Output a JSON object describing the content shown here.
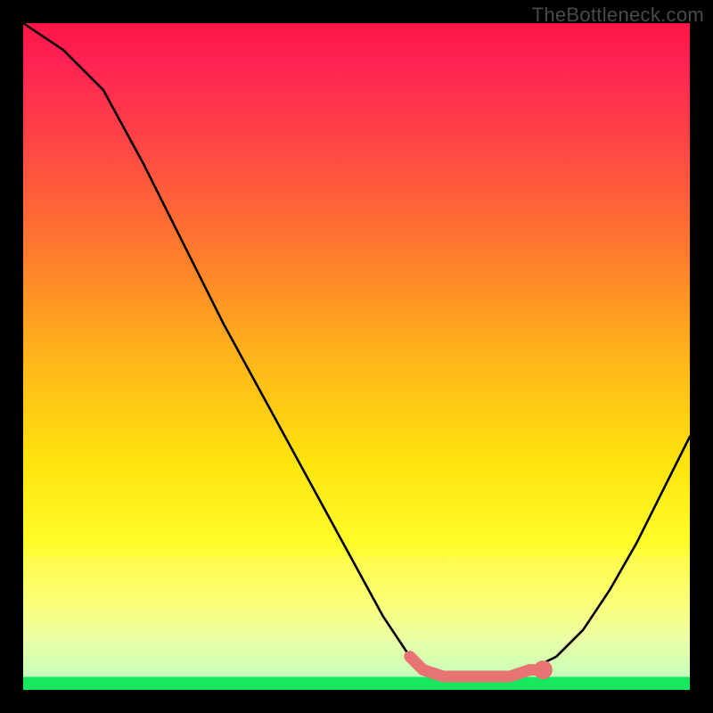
{
  "watermark": "TheBottleneck.com",
  "chart_data": {
    "type": "line",
    "title": "",
    "xlabel": "",
    "ylabel": "",
    "xlim": [
      0,
      100
    ],
    "ylim": [
      0,
      100
    ],
    "grid": false,
    "legend": false,
    "series": [
      {
        "name": "curve",
        "color": "#000000",
        "x": [
          0,
          6,
          12,
          18,
          24,
          30,
          36,
          42,
          48,
          54,
          58,
          60,
          63,
          66,
          70,
          73,
          76,
          80,
          84,
          88,
          92,
          96,
          100
        ],
        "y": [
          100,
          96,
          90,
          79,
          67,
          55,
          44,
          33,
          22,
          11,
          5,
          3,
          2,
          2,
          2,
          2,
          3,
          5,
          9,
          15,
          22,
          30,
          38
        ]
      }
    ],
    "highlight": {
      "name": "flat-zone",
      "color": "#e77373",
      "x": [
        58,
        60,
        63,
        66,
        70,
        73,
        76,
        78
      ],
      "y": [
        5,
        3,
        2,
        2,
        2,
        2,
        3,
        3
      ]
    },
    "highlight_dot": {
      "x": 78,
      "y": 3,
      "r": 1.4,
      "color": "#e77373"
    },
    "background_gradient": {
      "top": "#ff1646",
      "middle": "#ffe40e",
      "bottom": "#17e85e"
    }
  }
}
